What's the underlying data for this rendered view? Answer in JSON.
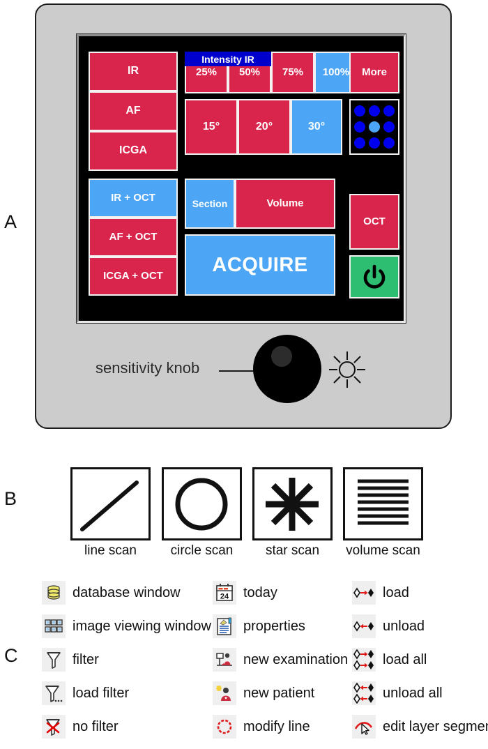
{
  "figure": {
    "panel_labels": [
      "A",
      "B",
      "C"
    ]
  },
  "panel_a": {
    "modality_buttons": [
      {
        "label": "IR",
        "state": "red"
      },
      {
        "label": "AF",
        "state": "red"
      },
      {
        "label": "ICGA",
        "state": "red"
      }
    ],
    "intensity": {
      "title": "Intensity IR",
      "options": [
        {
          "label": "25%",
          "state": "red"
        },
        {
          "label": "50%",
          "state": "red"
        },
        {
          "label": "75%",
          "state": "red"
        },
        {
          "label": "100%",
          "state": "blue"
        }
      ],
      "selected": "100%"
    },
    "field_angles": {
      "options": [
        {
          "label": "15°",
          "state": "red"
        },
        {
          "label": "20°",
          "state": "red"
        },
        {
          "label": "30°",
          "state": "blue"
        }
      ],
      "selected": "30°"
    },
    "more_button": {
      "label": "More",
      "state": "red"
    },
    "fixation_grid": {
      "name": "fixation-target-grid",
      "rows": 3,
      "cols": 3,
      "selected_index": 4,
      "dot_color": "#0000ee",
      "selected_color": "#4da6f5"
    },
    "combo_buttons": [
      {
        "label": "IR + OCT",
        "state": "blue"
      },
      {
        "label": "AF + OCT",
        "state": "red"
      },
      {
        "label": "ICGA + OCT",
        "state": "red"
      }
    ],
    "scan_mode": {
      "options": [
        {
          "label": "Section",
          "state": "blue"
        },
        {
          "label": "Volume",
          "state": "red"
        }
      ],
      "selected": "Section"
    },
    "acquire_button": {
      "label": "ACQUIRE",
      "state": "blue"
    },
    "oct_button": {
      "label": "OCT",
      "state": "red"
    },
    "power_button": {
      "label": "",
      "icon": "power-icon",
      "state": "green"
    },
    "knob": {
      "label": "sensitivity knob",
      "brightness_icon": "brightness-sun-icon"
    },
    "colors": {
      "red": "#d9254c",
      "blue": "#4da6f5",
      "green": "#2dbe72",
      "header_blue": "#0000cc",
      "device_body": "#cccccc",
      "screen": "#000000"
    }
  },
  "panel_b": {
    "scans": [
      {
        "icon": "line-scan-icon",
        "caption": "line scan"
      },
      {
        "icon": "circle-scan-icon",
        "caption": "circle scan"
      },
      {
        "icon": "star-scan-icon",
        "caption": "star scan"
      },
      {
        "icon": "volume-scan-icon",
        "caption": "volume scan"
      }
    ]
  },
  "panel_c": {
    "columns": [
      {
        "items": [
          {
            "icon": "database-window-icon",
            "label": "database window"
          },
          {
            "icon": "image-viewing-window-icon",
            "label": "image viewing window"
          },
          {
            "icon": "filter-icon",
            "label": "filter"
          },
          {
            "icon": "load-filter-icon",
            "label": "load filter"
          },
          {
            "icon": "no-filter-icon",
            "label": "no filter"
          }
        ]
      },
      {
        "items": [
          {
            "icon": "today-calendar-icon",
            "label": "today"
          },
          {
            "icon": "properties-icon",
            "label": "properties"
          },
          {
            "icon": "new-examination-icon",
            "label": "new examination"
          },
          {
            "icon": "new-patient-icon",
            "label": "new patient"
          },
          {
            "icon": "modify-line-icon",
            "label": "modify line"
          }
        ]
      },
      {
        "items": [
          {
            "icon": "load-icon",
            "label": "load"
          },
          {
            "icon": "unload-icon",
            "label": "unload"
          },
          {
            "icon": "load-all-icon",
            "label": "load all"
          },
          {
            "icon": "unload-all-icon",
            "label": "unload all"
          },
          {
            "icon": "edit-layer-segmentation-icon",
            "label": "edit layer segmentation"
          }
        ]
      }
    ]
  }
}
